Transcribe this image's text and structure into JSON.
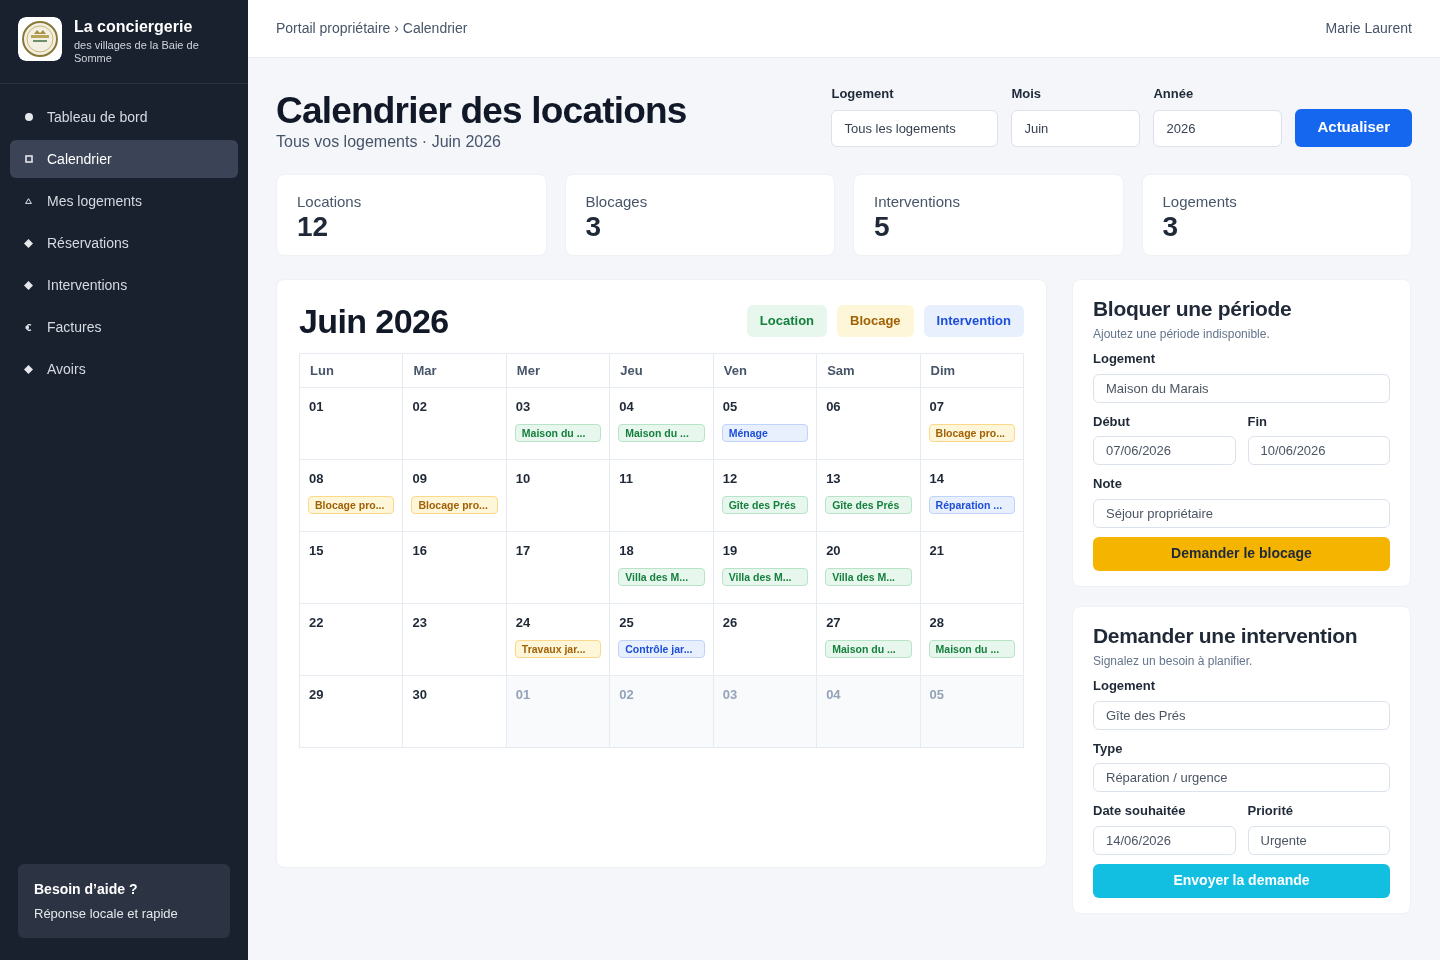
{
  "sidebar": {
    "brand": {
      "title": "La conciergerie",
      "subtitle": "des villages de la Baie de Somme"
    },
    "items": [
      {
        "label": "Tableau de bord",
        "kind": "dot",
        "selected": false
      },
      {
        "label": "Calendrier",
        "kind": "square",
        "selected": true
      },
      {
        "label": "Mes logements",
        "kind": "house",
        "selected": false
      },
      {
        "label": "Réservations",
        "kind": "diamond",
        "selected": false
      },
      {
        "label": "Interventions",
        "kind": "diamond",
        "selected": false
      },
      {
        "label": "Factures",
        "kind": "euro",
        "selected": false
      },
      {
        "label": "Avoirs",
        "kind": "diamond",
        "selected": false
      }
    ],
    "help": {
      "title": "Besoin d’aide ?",
      "text": "Réponse locale et rapide"
    }
  },
  "header": {
    "breadcrumb": "Portail propriétaire › Calendrier",
    "user": "Marie Laurent"
  },
  "page": {
    "title": "Calendrier des locations",
    "subtitle": "Tous vos logements · Juin 2026",
    "filters": [
      {
        "label": "Logement",
        "value": "Tous les logements"
      },
      {
        "label": "Mois",
        "value": "Juin"
      },
      {
        "label": "Année",
        "value": "2026"
      }
    ],
    "refresh": "Actualiser"
  },
  "stats": [
    {
      "label": "Locations",
      "value": "12"
    },
    {
      "label": "Blocages",
      "value": "3"
    },
    {
      "label": "Interventions",
      "value": "5"
    },
    {
      "label": "Logements",
      "value": "3"
    }
  ],
  "calendar": {
    "title": "Juin 2026",
    "legend": [
      {
        "label": "Location",
        "kind": "location"
      },
      {
        "label": "Blocage",
        "kind": "blocage"
      },
      {
        "label": "Intervention",
        "kind": "intervention"
      }
    ],
    "weekdays": [
      "Lun",
      "Mar",
      "Mer",
      "Jeu",
      "Ven",
      "Sam",
      "Dim"
    ],
    "days": [
      {
        "day": "01",
        "outside": false
      },
      {
        "day": "02",
        "outside": false
      },
      {
        "day": "03",
        "outside": false,
        "event": {
          "label": "Maison du ...",
          "kind": "location"
        }
      },
      {
        "day": "04",
        "outside": false,
        "event": {
          "label": "Maison du ...",
          "kind": "location"
        }
      },
      {
        "day": "05",
        "outside": false,
        "event": {
          "label": "Ménage",
          "kind": "intervention"
        }
      },
      {
        "day": "06",
        "outside": false
      },
      {
        "day": "07",
        "outside": false,
        "event": {
          "label": "Blocage pro...",
          "kind": "blocage"
        }
      },
      {
        "day": "08",
        "outside": false,
        "event": {
          "label": "Blocage pro...",
          "kind": "blocage"
        }
      },
      {
        "day": "09",
        "outside": false,
        "event": {
          "label": "Blocage pro...",
          "kind": "blocage"
        }
      },
      {
        "day": "10",
        "outside": false
      },
      {
        "day": "11",
        "outside": false
      },
      {
        "day": "12",
        "outside": false,
        "event": {
          "label": "Gîte des Prés",
          "kind": "location"
        }
      },
      {
        "day": "13",
        "outside": false,
        "event": {
          "label": "Gîte des Prés",
          "kind": "location"
        }
      },
      {
        "day": "14",
        "outside": false,
        "event": {
          "label": "Réparation ...",
          "kind": "intervention"
        }
      },
      {
        "day": "15",
        "outside": false
      },
      {
        "day": "16",
        "outside": false
      },
      {
        "day": "17",
        "outside": false
      },
      {
        "day": "18",
        "outside": false,
        "event": {
          "label": "Villa des M...",
          "kind": "location"
        }
      },
      {
        "day": "19",
        "outside": false,
        "event": {
          "label": "Villa des M...",
          "kind": "location"
        }
      },
      {
        "day": "20",
        "outside": false,
        "event": {
          "label": "Villa des M...",
          "kind": "location"
        }
      },
      {
        "day": "21",
        "outside": false
      },
      {
        "day": "22",
        "outside": false
      },
      {
        "day": "23",
        "outside": false
      },
      {
        "day": "24",
        "outside": false,
        "event": {
          "label": "Travaux jar...",
          "kind": "blocage"
        }
      },
      {
        "day": "25",
        "outside": false,
        "event": {
          "label": "Contrôle jar...",
          "kind": "intervention"
        }
      },
      {
        "day": "26",
        "outside": false
      },
      {
        "day": "27",
        "outside": false,
        "event": {
          "label": "Maison du ...",
          "kind": "location"
        }
      },
      {
        "day": "28",
        "outside": false,
        "event": {
          "label": "Maison du ...",
          "kind": "location"
        }
      },
      {
        "day": "29",
        "outside": false
      },
      {
        "day": "30",
        "outside": false
      },
      {
        "day": "01",
        "outside": true
      },
      {
        "day": "02",
        "outside": true
      },
      {
        "day": "03",
        "outside": true
      },
      {
        "day": "04",
        "outside": true
      },
      {
        "day": "05",
        "outside": true
      }
    ]
  },
  "block_form": {
    "title": "Bloquer une période",
    "subtitle": "Ajoutez une période indisponible.",
    "rows": [
      [
        {
          "label": "Logement",
          "value": "Maison du Marais"
        }
      ],
      [
        {
          "label": "Début",
          "value": "07/06/2026"
        },
        {
          "label": "Fin",
          "value": "10/06/2026"
        }
      ],
      [
        {
          "label": "Note",
          "value": "Séjour propriétaire"
        }
      ]
    ],
    "button": "Demander le blocage"
  },
  "intervention_form": {
    "title": "Demander une intervention",
    "subtitle": "Signalez un besoin à planifier.",
    "rows": [
      [
        {
          "label": "Logement",
          "value": "Gîte des Prés"
        }
      ],
      [
        {
          "label": "Type",
          "value": "Réparation / urgence"
        }
      ],
      [
        {
          "label": "Date souhaitée",
          "value": "14/06/2026"
        },
        {
          "label": "Priorité",
          "value": "Urgente"
        }
      ]
    ],
    "button": "Envoyer la demande"
  }
}
